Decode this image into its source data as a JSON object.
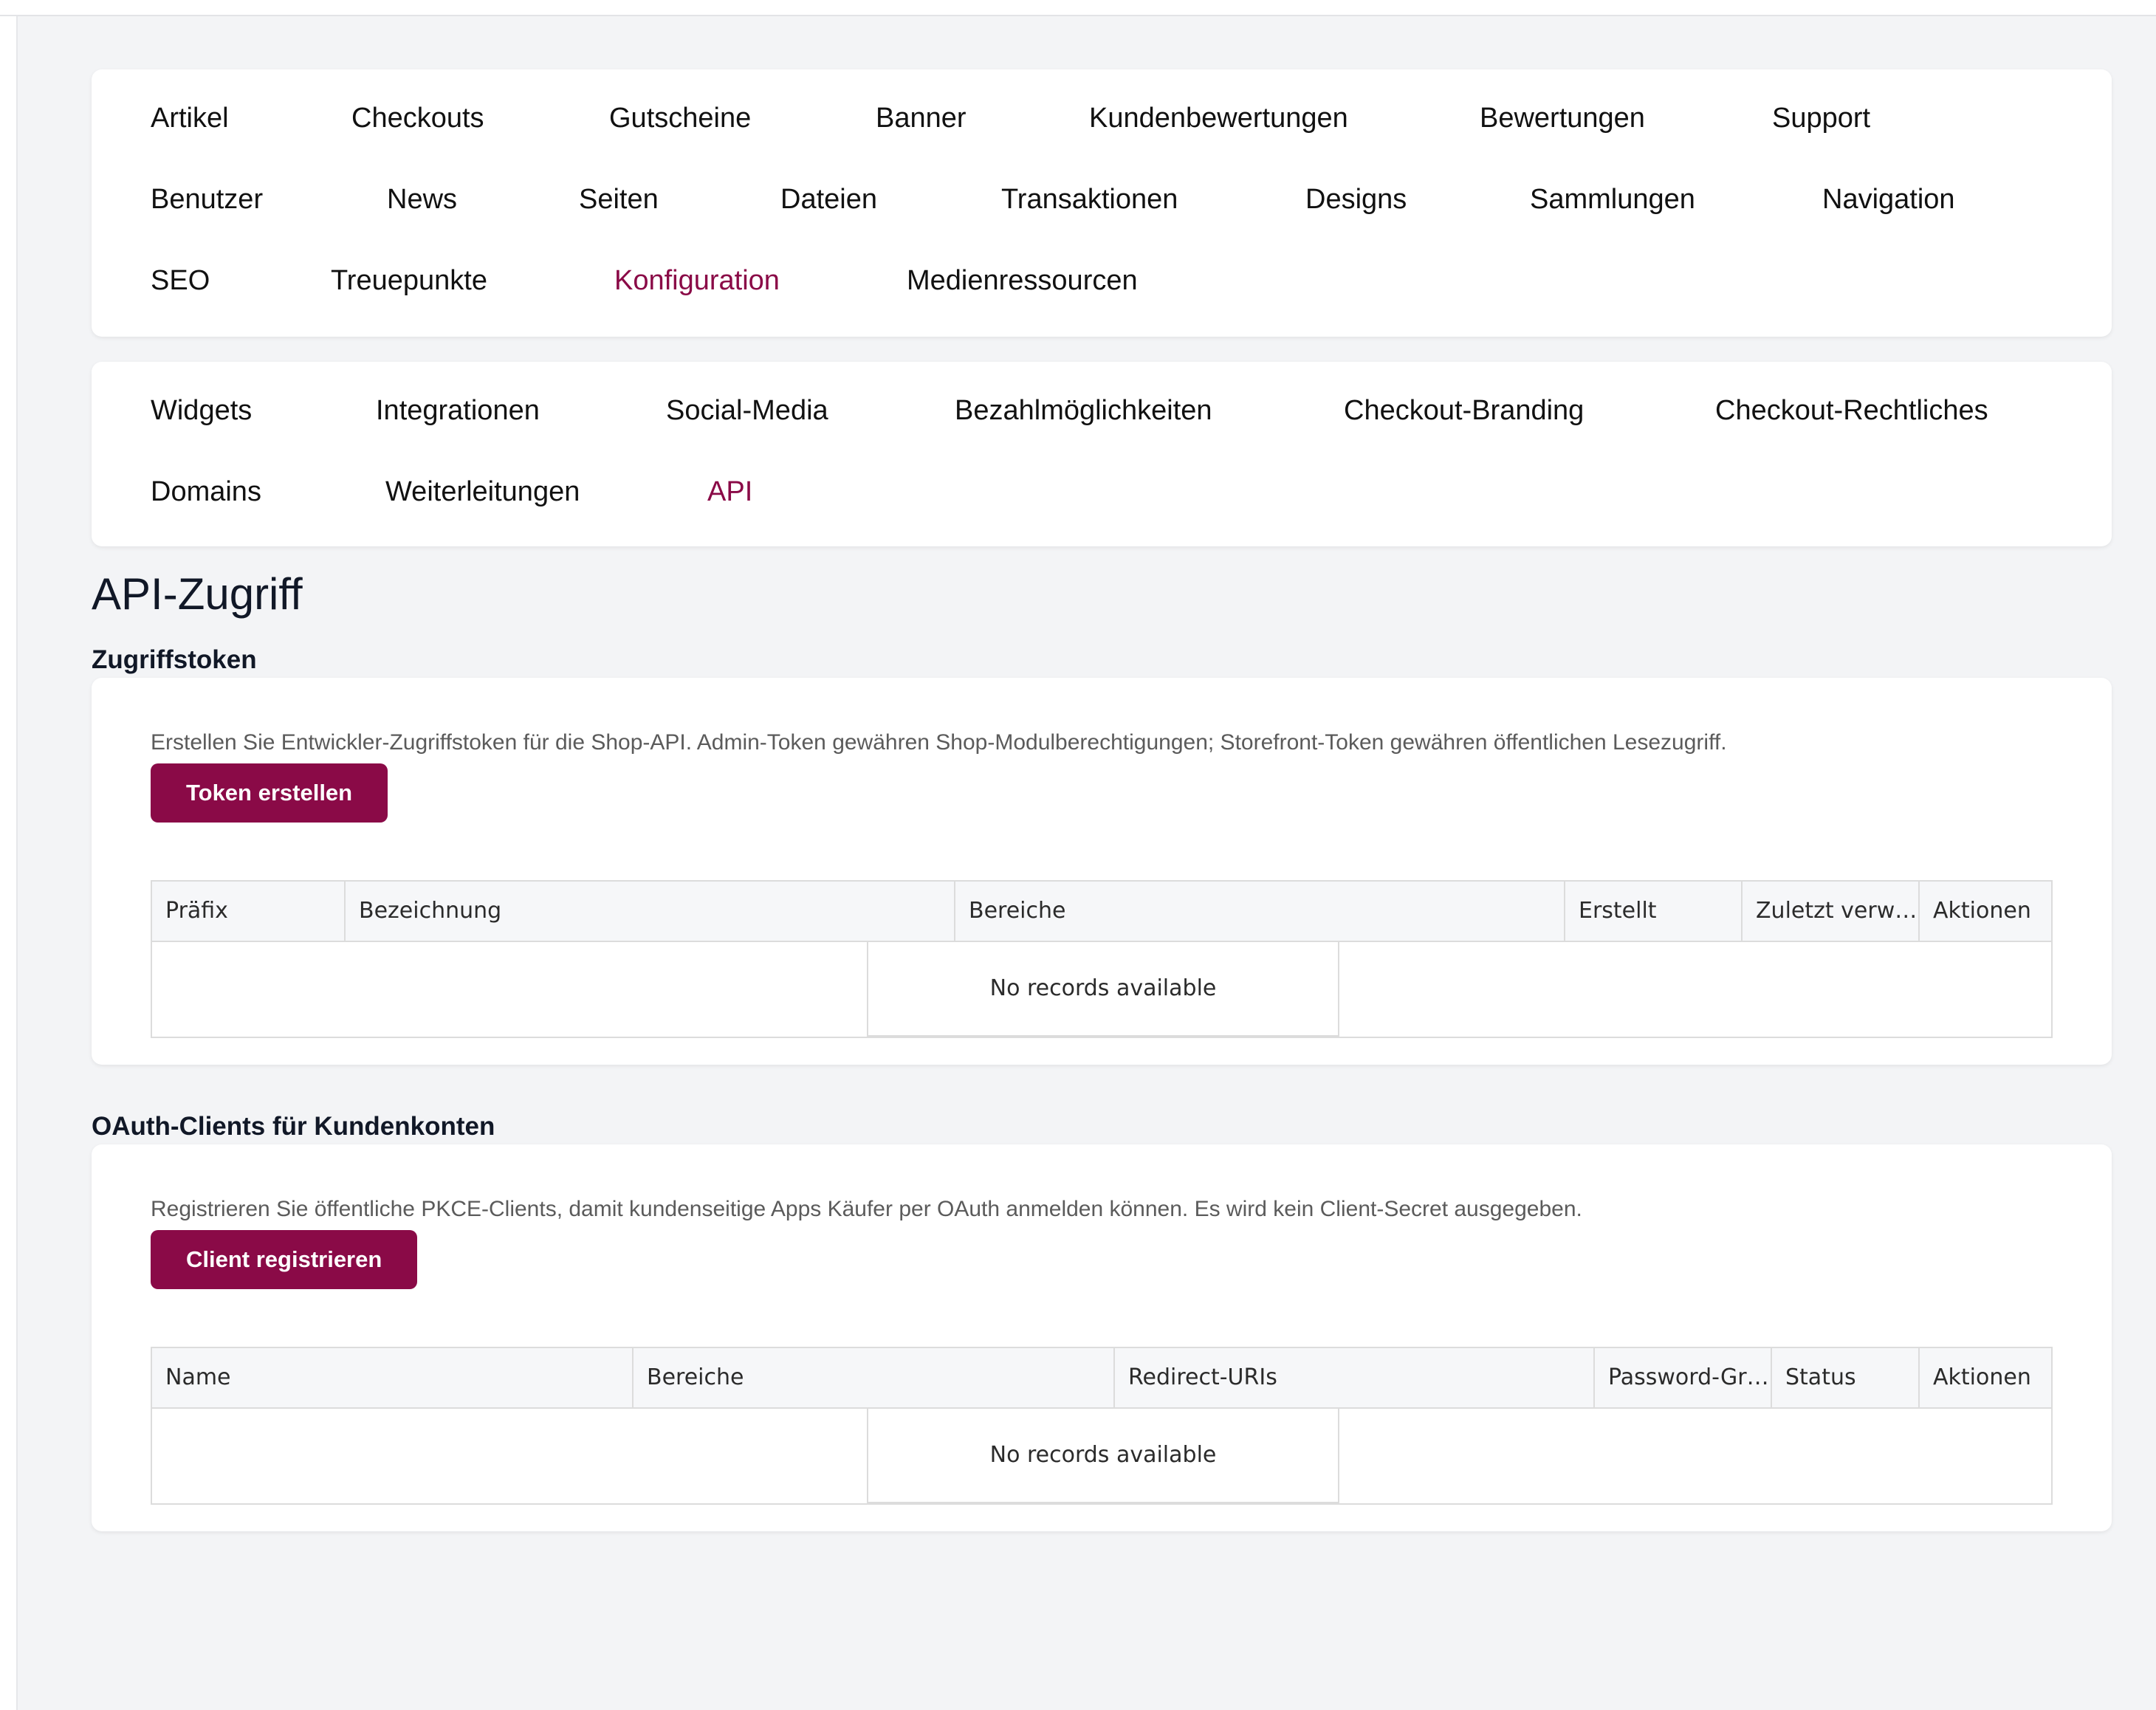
{
  "main_nav": {
    "active": "Konfiguration",
    "items": [
      "Artikel",
      "Checkouts",
      "Gutscheine",
      "Banner",
      "Kundenbewertungen",
      "Bewertungen",
      "Support",
      "Benutzer",
      "News",
      "Seiten",
      "Dateien",
      "Transaktionen",
      "Designs",
      "Sammlungen",
      "Navigation",
      "SEO",
      "Treuepunkte",
      "Konfiguration",
      "Medienressourcen"
    ]
  },
  "sub_nav": {
    "active": "API",
    "items": [
      "Widgets",
      "Integrationen",
      "Social-Media",
      "Bezahlmöglichkeiten",
      "Checkout-Branding",
      "Checkout-Rechtliches",
      "Domains",
      "Weiterleitungen",
      "API"
    ]
  },
  "page": {
    "title": "API-Zugriff"
  },
  "tokens": {
    "heading": "Zugriffstoken",
    "description": "Erstellen Sie Entwickler-Zugriffstoken für die Shop-API. Admin-Token gewähren Shop-Modulberechtigungen; Storefront-Token gewähren öffentlichen Lesezugriff.",
    "button_label": "Token erstellen",
    "columns": [
      "Präfix",
      "Bezeichnung",
      "Bereiche",
      "Erstellt",
      "Zuletzt verwendet",
      "Aktionen"
    ],
    "empty_text": "No records available"
  },
  "oauth": {
    "heading": "OAuth-Clients für Kundenkonten",
    "description": "Registrieren Sie öffentliche PKCE-Clients, damit kundenseitige Apps Käufer per OAuth anmelden können. Es wird kein Client-Secret ausgegeben.",
    "button_label": "Client registrieren",
    "columns": [
      "Name",
      "Bereiche",
      "Redirect-URIs",
      "Password-Grant",
      "Status",
      "Aktionen"
    ],
    "empty_text": "No records available"
  },
  "colors": {
    "accent": "#8a0a47",
    "background": "#f3f4f6",
    "card": "#ffffff"
  }
}
